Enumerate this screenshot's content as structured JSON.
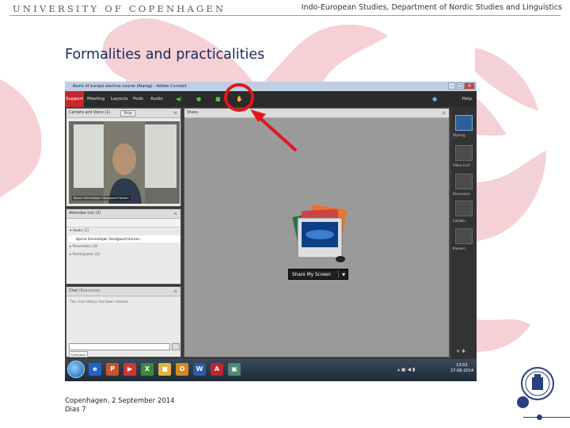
{
  "slide": {
    "university": "UNIVERSITY OF COPENHAGEN",
    "department": "Indo-European Studies, Department of Nordic Studies and Linguistics",
    "title": "Formalities and practicalities",
    "footer_date": "Copenhagen, 2 September 2014",
    "footer_slide": "Dias 7"
  },
  "app": {
    "window_title": "Roots of europe elective course (Alarog) - Adobe Connect",
    "menu": [
      "Support",
      "Meeting",
      "Layouts",
      "Pods",
      "Audio"
    ],
    "help_label": "Help"
  },
  "camera_pod": {
    "title": "Camera and Voice (1)",
    "stop_label": "Stop",
    "video_label": "Bjarne Simmelkjær Sandgaard Hansen"
  },
  "attendee_pod": {
    "title": "Attendee List (3)",
    "groups": [
      {
        "label": "Hosts (1)",
        "members": [
          "Bjarne Simmelkjær Sandgaard Hansen"
        ]
      },
      {
        "label": "Presenters (0)",
        "members": []
      },
      {
        "label": "Participants (2)",
        "members": []
      }
    ]
  },
  "chat_pod": {
    "title": "Chat",
    "title_suffix": "(Everyone)",
    "history_note": "The chat history has been cleared",
    "recipient": "Everyone"
  },
  "share_pod": {
    "title": "Share",
    "share_button": "Share My Screen"
  },
  "layouts": [
    "Sharing",
    "Video Conf",
    "Discussion",
    "Collabo...",
    "Present..."
  ],
  "taskbar": {
    "time": "13:02",
    "date": "27-08-2014"
  },
  "colors": {
    "title_blue": "#1b2a59",
    "support_red": "#c8272a",
    "annotation_red": "#e3161c"
  }
}
